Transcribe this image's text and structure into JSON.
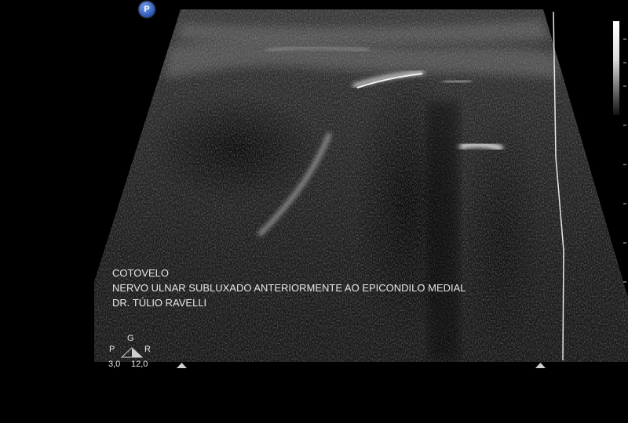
{
  "probe_marker": {
    "label": "P"
  },
  "annotation": {
    "line1": "COTOVELO",
    "line2": "NERVO ULNAR SUBLUXADO ANTERIORMENTE AO EPICONDILO MEDIAL",
    "line3": "DR. TÚLIO RAVELLI"
  },
  "parameters": {
    "p_label": "P",
    "g_label": "G",
    "r_label": "R",
    "p_value": "3,0",
    "r_value": "12,0"
  },
  "icons": [
    "gain-triangle-icon",
    "focus-marker-icon",
    "grayscale-bar"
  ]
}
